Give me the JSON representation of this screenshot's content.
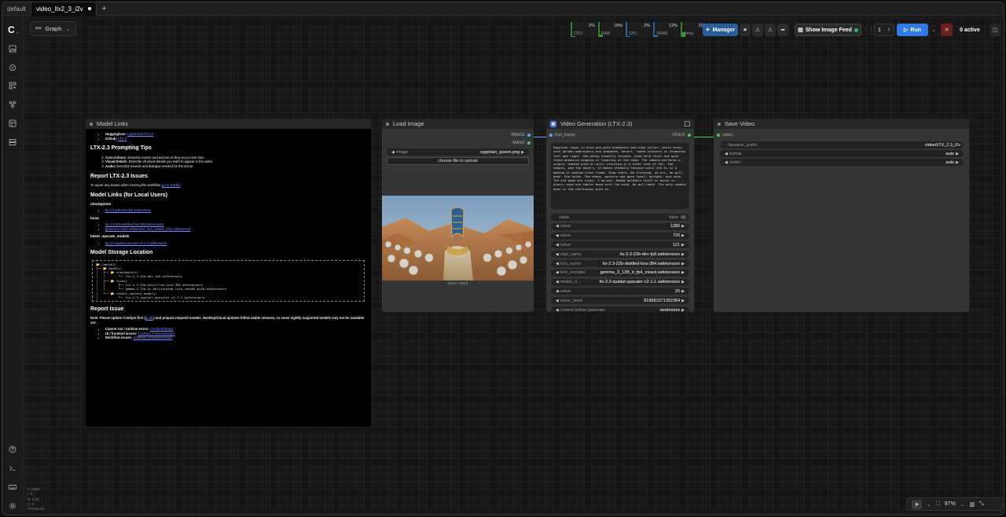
{
  "tabs": [
    {
      "label": "default",
      "active": false
    },
    {
      "label": "video_ltx2_3_i2v",
      "active": true,
      "modified": true
    }
  ],
  "toolbar": {
    "graph_label": "Graph",
    "monitors": [
      {
        "label": "CPU",
        "value": "2%",
        "level": 0.02
      },
      {
        "label": "RAM",
        "value": "16%",
        "level": 0.16
      },
      {
        "label": "GPU",
        "value": "2%",
        "level": 0.02
      },
      {
        "label": "VRAM",
        "value": "12%",
        "level": 0.12
      },
      {
        "label": "Temp",
        "value": "30°",
        "level": 0.3
      }
    ],
    "manager_label": "Manager",
    "show_feed_label": "Show Image Feed",
    "queue_count": "1",
    "run_label": "Run",
    "active_label": "0 active"
  },
  "model_links": {
    "title": "Model Links",
    "hf_label": "Huggingface:",
    "hf_link": "Lightricks/LTX-2.3",
    "gh_label": "Github:",
    "gh_link": "LTX-2",
    "tips_heading": "LTX-2.3 Prompting Tips",
    "tips": [
      {
        "bold": "Core Actions:",
        "text": " Describe events and actions as they occur over time"
      },
      {
        "bold": "Visual Details:",
        "text": " Describe all visual details you want to appear in the video"
      },
      {
        "bold": "Audio:",
        "text": " Describe sounds and dialogue needed for the scene"
      }
    ],
    "report_heading": "Report LTX-2.3 Issues",
    "report_text": "To report any issues when running this workflow, ",
    "report_link": "go to GitHub",
    "local_heading": "Model Links (for Local Users)",
    "checkpoints_label": "checkpoints",
    "checkpoints": [
      "ltx-2.3-22b-dev-fp8.safetensors"
    ],
    "loras_label": "loras",
    "loras": [
      "ltx-2.3-22b-distilled-lora-384.safetensors",
      "gemma-3-12b-it-abliterated_lora_rank64_bf16.safetensors"
    ],
    "upscale_label": "latent_upscale_models",
    "upscale": [
      "ltx-2.3-spatial-upscaler-x2-1.1.safetensors"
    ],
    "storage_heading": "Model Storage Location",
    "storage_tree": "📂 ComfyUI/\n├── 📂 models/\n│   ├── 📂 checkpoints/\n│   │       └── ltx-2.3-22b-dev-fp8.safetensors\n│   ├── 📂 loras/\n│   │       ├── ltx-2.3-22b-distilled-lora-384.safetensors\n│   │       └── gemma-3-12b-it-abliterated_lora_rank64_bf16.safetensors\n│   └── 📂 latent_upscale_models/\n│           └── ltx-2.3-spatial-upscaler-x2-1.1.safetensors",
    "issue_heading": "Report Issue",
    "issue_note_bold": "Note: Please update ComfyUI first (",
    "issue_note_link": "guide",
    "issue_note_rest": ") and prepare required models. Desktop/Cloud updates follow stable releases, so some nightly-supported models may not be available yet.",
    "issue_items": [
      {
        "label": "Cannot run / runtime errors: ",
        "link": "ComfyUI/issues"
      },
      {
        "label": "UI / frontend issues: ",
        "link": "ComfyUI_frontend/issues"
      },
      {
        "label": "Workflow issues: ",
        "link": "workflow_templates/issues"
      }
    ]
  },
  "load_image": {
    "title": "Load Image",
    "out_image": "IMAGE",
    "out_mask": "MASK",
    "image_label": "image",
    "image_value": "egyptian_queen.png",
    "upload_label": "choose file to upload",
    "size_label": "2512 × 2512"
  },
  "video_gen": {
    "title": "Video Generation (LTX-2.3)",
    "in_label": "first_frame",
    "out_label": "VIDEO",
    "prompt": "Egyptian royal in blue-and-gold headdress and high collar, white dress with golden embroidery and armbands, desert, robed soldiers in formation left and right. She walks steadily forward, head held level and gaze fixed ahead—no dipping or lowering of the head. The camera performs a single, smooth push-in only: starting in a wider shot of her, the robots, and the desert, it moves steadily forward until she is in a medium or medium-close frame. Stop there. No trucking, no arc, no pull-back. She holds. The shoes, posture and gaze level; upright, and calm. The old gods are risen. I am one. Robed soldiers shift or march in place; sand and fabric move with the wind. No pull-back. The only camera move is the continuous push-in.",
    "widgets": [
      {
        "label": "value",
        "value": "false",
        "toggle": true
      },
      {
        "label": "value",
        "value": "1280"
      },
      {
        "label": "value",
        "value": "720"
      },
      {
        "label": "value",
        "value": "121"
      },
      {
        "label": "ckpt_name",
        "value": "ltx-2.3-22b-dev-fp8.safetensors"
      },
      {
        "label": "lora_name",
        "value": "ltx-2.3-22b-distilled-lora-384.safetensors"
      },
      {
        "label": "text_encoder",
        "value": "gemma_3_12B_it_fp4_mixed.safetensors"
      },
      {
        "label": "model_n...",
        "value": "ltx-2.3-spatial-upscaler-x2-1.1.safetensors"
      },
      {
        "label": "value",
        "value": "25"
      },
      {
        "label": "noise_seed",
        "value": "819681071352364"
      },
      {
        "label": "control before generate",
        "value": "randomize"
      }
    ]
  },
  "save_video": {
    "title": "Save Video",
    "in_label": "video",
    "widgets": [
      {
        "label": "filename_prefix",
        "value": "video/LTX_2.3_i2v"
      },
      {
        "label": "format",
        "value": "auto"
      },
      {
        "label": "codec",
        "value": "auto"
      }
    ]
  },
  "stats": [
    "T: 0.00s",
    "I: 0",
    "N: 4 [4]",
    "V: 0",
    "FPS:60.61"
  ],
  "zoom": {
    "value": "97%"
  },
  "colors": {
    "accent": "#2f7be3",
    "link": "#7b8cff",
    "video_port": "#4ec27a",
    "image_port": "#5ea5f5"
  }
}
